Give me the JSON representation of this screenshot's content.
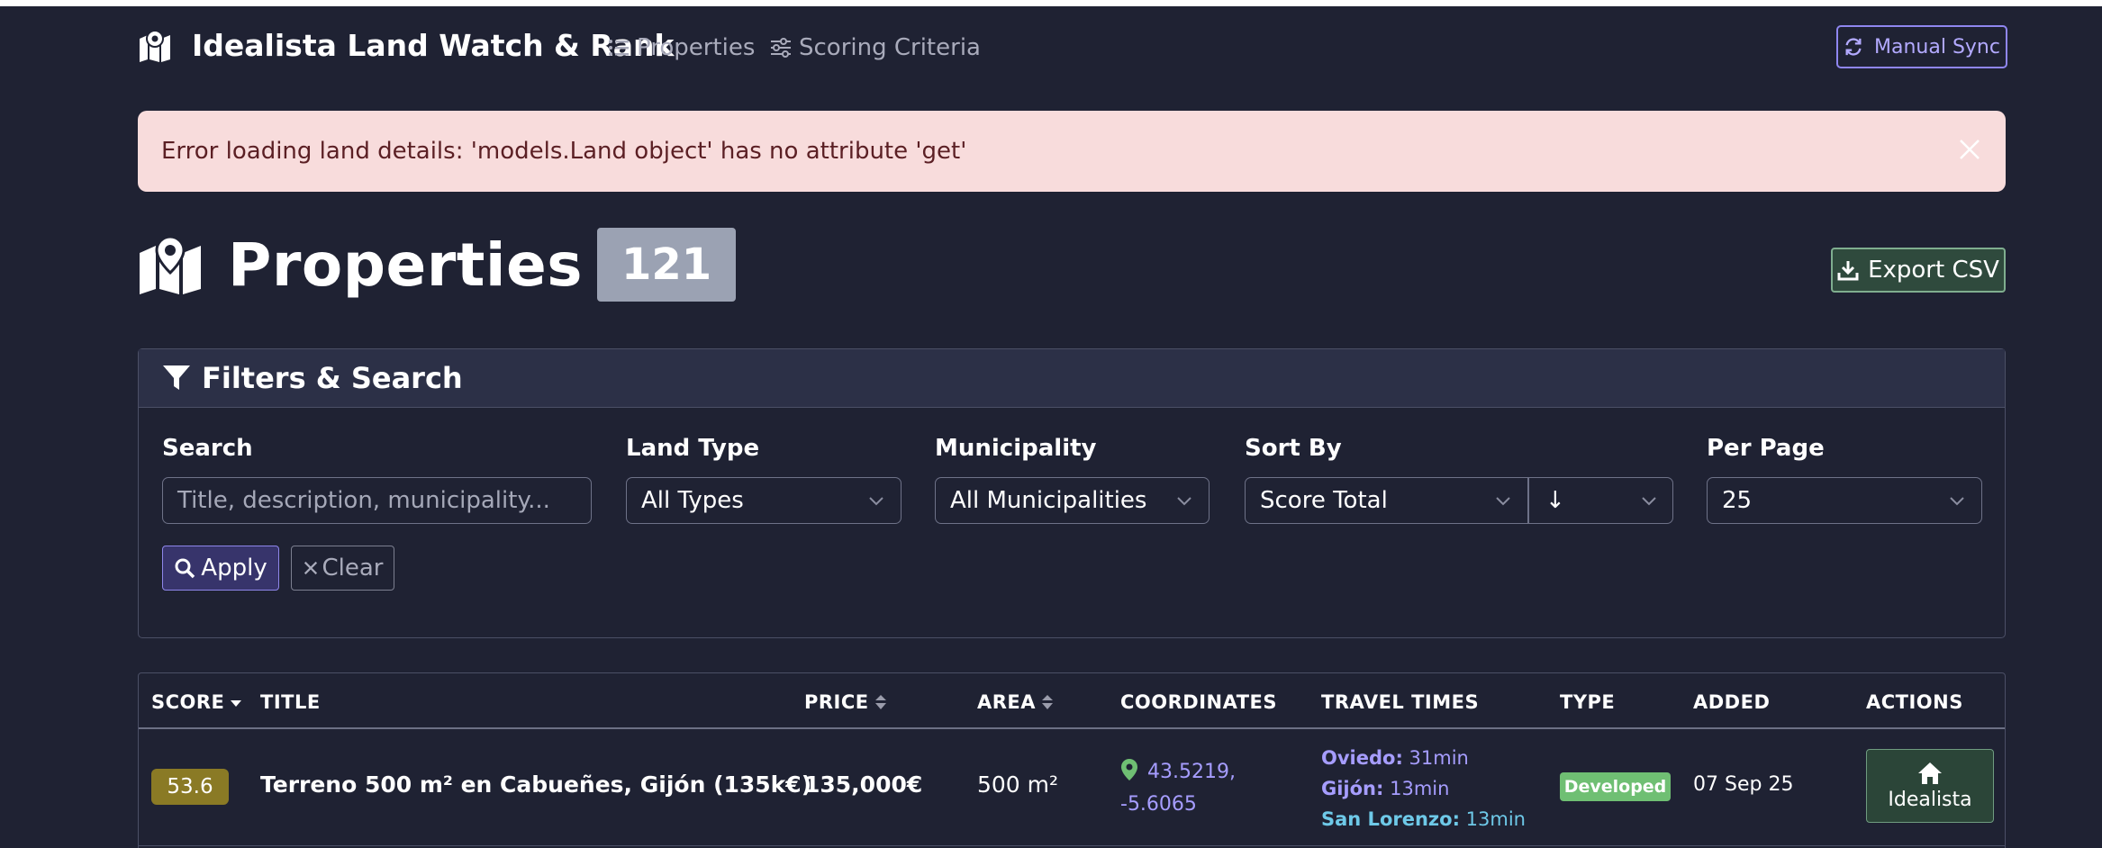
{
  "navbar": {
    "brand": "Idealista Land Watch & Rank",
    "links": [
      {
        "label": "Properties",
        "icon": "list-icon"
      },
      {
        "label": "Scoring Criteria",
        "icon": "sliders-icon"
      }
    ],
    "sync_button": "Manual Sync"
  },
  "alert": {
    "message": "Error loading land details: 'models.Land object' has no attribute 'get'"
  },
  "page": {
    "title": "Properties",
    "count": "121",
    "export_button": "Export CSV"
  },
  "filters": {
    "header": "Filters & Search",
    "search_label": "Search",
    "search_placeholder": "Title, description, municipality...",
    "land_type_label": "Land Type",
    "land_type_value": "All Types",
    "municipality_label": "Municipality",
    "municipality_value": "All Municipalities",
    "sort_label": "Sort By",
    "sort_value": "Score Total",
    "sort_direction": "↓",
    "per_page_label": "Per Page",
    "per_page_value": "25",
    "apply_button": "Apply",
    "clear_button": "Clear"
  },
  "table": {
    "columns": [
      "SCORE",
      "TITLE",
      "PRICE",
      "AREA",
      "COORDINATES",
      "TRAVEL TIMES",
      "TYPE",
      "ADDED",
      "ACTIONS"
    ],
    "rows": [
      {
        "score": "53.6",
        "title": "Terreno 500 m² en Cabueñes, Gijón (135k€)",
        "price": "135,000€",
        "area": "500 m²",
        "coordinates": "43.5219, -5.6065",
        "travel": [
          {
            "label": "Oviedo:",
            "value": "31min"
          },
          {
            "label": "Gijón:",
            "value": "13min"
          },
          {
            "label": "San Lorenzo:",
            "value": "13min"
          }
        ],
        "type": "Developed",
        "added": "07 Sep 25",
        "action": "Idealista"
      }
    ]
  },
  "colors": {
    "background": "#1f2233",
    "accent": "#8f86f0",
    "alert_bg": "#f8dcdc",
    "score_badge": "#8a7a25",
    "type_badge": "#6fbf73",
    "success_btn": "#2f4a3d"
  }
}
